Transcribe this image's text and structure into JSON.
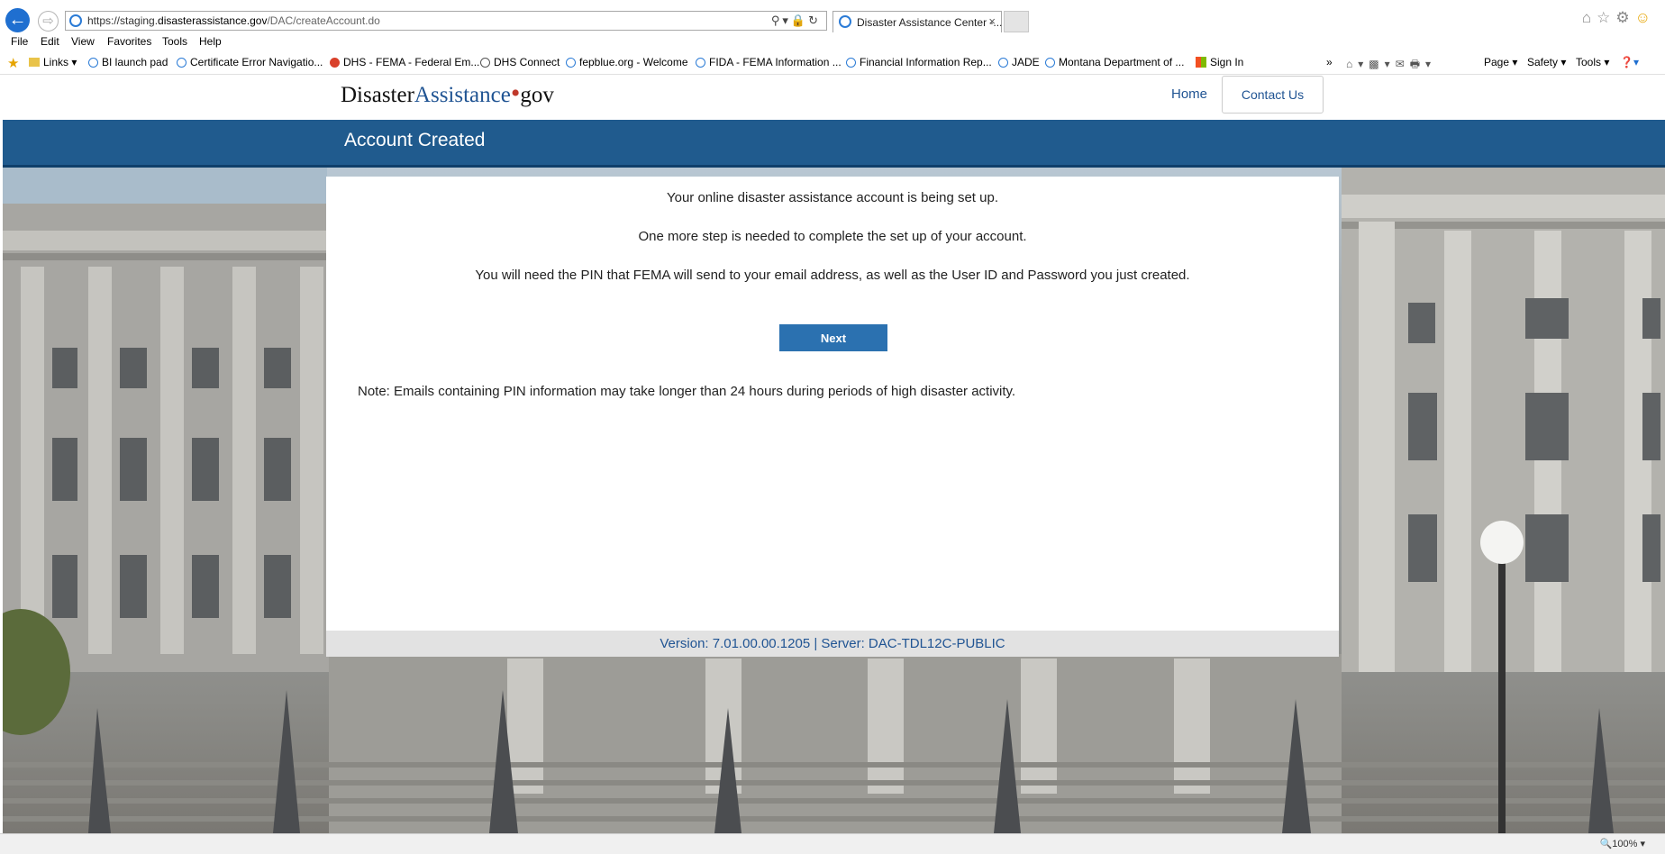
{
  "browser": {
    "url_prefix": "https://staging.",
    "url_domain": "disasterassistance.gov",
    "url_path": "/DAC/createAccount.do",
    "tab_title": "Disaster Assistance Center -...",
    "tab_close": "×",
    "menu": [
      "File",
      "Edit",
      "View",
      "Favorites",
      "Tools",
      "Help"
    ],
    "favorites": [
      "Links ▾",
      "BI launch pad",
      "Certificate Error Navigatio...",
      "DHS - FEMA - Federal Em...",
      "DHS Connect",
      "fepblue.org - Welcome",
      "FIDA - FEMA Information ...",
      "Financial Information Rep...",
      "JADE",
      "Montana Department of ...",
      "Sign In"
    ],
    "commands": [
      "Page ▾",
      "Safety ▾",
      "Tools ▾"
    ],
    "zoom": "100%",
    "overflow": "»"
  },
  "site": {
    "logo_part1": "Disaster",
    "logo_part2": "Assistance",
    "logo_dot": "•",
    "logo_part3": "gov",
    "nav_home": "Home",
    "nav_contact": "Contact Us"
  },
  "page": {
    "title": "Account Created",
    "line1": "Your online disaster assistance account is being set up.",
    "line2": "One more step is needed to complete the set up of your account.",
    "line3": "You will need the PIN that FEMA will send to your email address, as well as the User ID and Password you just created.",
    "next_button": "Next",
    "note": "Note: Emails containing PIN information may take longer than 24 hours during periods of high disaster activity.",
    "footer": "Version: 7.01.00.00.1205  |  Server: DAC-TDL12C-PUBLIC"
  },
  "colors": {
    "brand_blue": "#205493",
    "title_bar": "#205b8e",
    "button": "#2b71b0"
  }
}
